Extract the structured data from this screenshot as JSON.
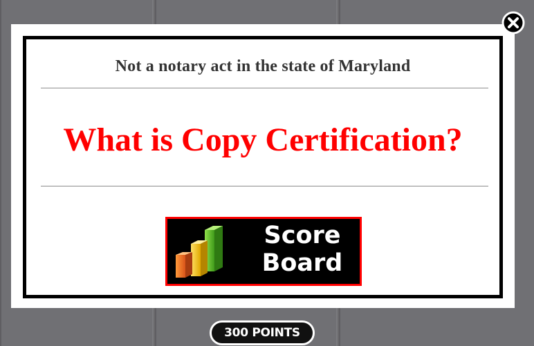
{
  "modal": {
    "subtitle": "Not a notary act in the state of Maryland",
    "question": "What is Copy Certification?",
    "scoreboard": {
      "line1": "Score",
      "line2": "Board",
      "icon": "bar-chart-icon"
    },
    "close_icon": "close-icon"
  },
  "footer": {
    "points": "300 POINTS"
  },
  "colors": {
    "question": "#ff0000",
    "button_border": "#ff0000",
    "button_bg": "#000000",
    "subtitle": "#333333",
    "backdrop": "#6b6b6e"
  }
}
